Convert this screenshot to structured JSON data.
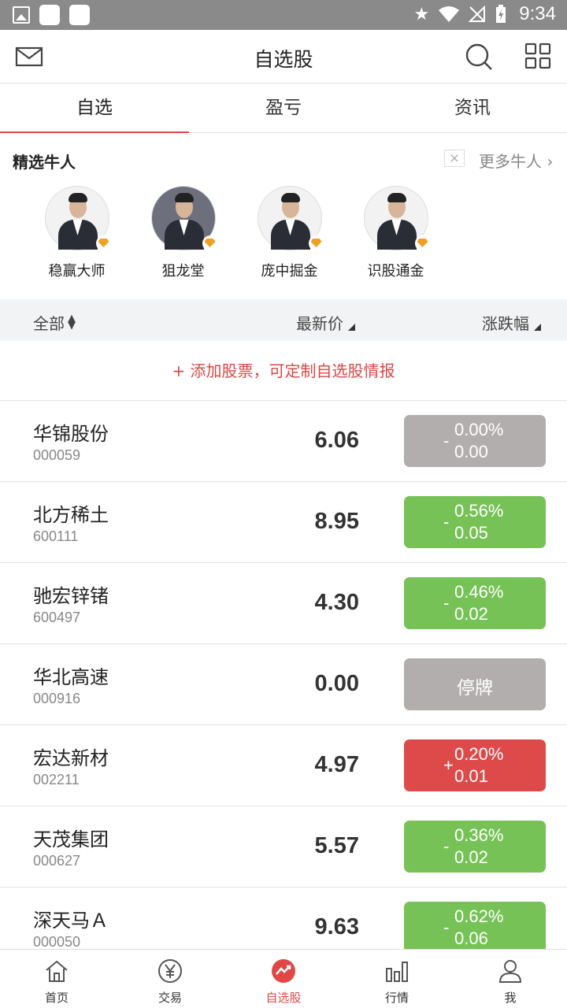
{
  "status_bar": {
    "time": "9:34"
  },
  "header": {
    "title": "自选股"
  },
  "tabs": [
    {
      "label": "自选",
      "active": true
    },
    {
      "label": "盈亏",
      "active": false
    },
    {
      "label": "资讯",
      "active": false
    }
  ],
  "experts": {
    "title": "精选牛人",
    "close_label": "×",
    "more_label": "更多牛人 ›",
    "items": [
      {
        "name": "稳赢大师"
      },
      {
        "name": "狙龙堂"
      },
      {
        "name": "庞中掘金"
      },
      {
        "name": "识股通金"
      }
    ]
  },
  "columns": {
    "all": "全部",
    "price": "最新价",
    "change": "涨跌幅"
  },
  "add_stock": {
    "label": "+ 添加股票，可定制自选股情报"
  },
  "stocks": [
    {
      "name": "华锦股份",
      "code": "000059",
      "price": "6.06",
      "sign": "-",
      "pct": "0.00%",
      "amt": "0.00",
      "status": "flat"
    },
    {
      "name": "北方稀土",
      "code": "600111",
      "price": "8.95",
      "sign": "-",
      "pct": "0.56%",
      "amt": "0.05",
      "status": "down"
    },
    {
      "name": "驰宏锌锗",
      "code": "600497",
      "price": "4.30",
      "sign": "-",
      "pct": "0.46%",
      "amt": "0.02",
      "status": "down"
    },
    {
      "name": "华北高速",
      "code": "000916",
      "price": "0.00",
      "halt": "停牌",
      "status": "halt"
    },
    {
      "name": "宏达新材",
      "code": "002211",
      "price": "4.97",
      "sign": "+",
      "pct": "0.20%",
      "amt": "0.01",
      "status": "up"
    },
    {
      "name": "天茂集团",
      "code": "000627",
      "price": "5.57",
      "sign": "-",
      "pct": "0.36%",
      "amt": "0.02",
      "status": "down"
    },
    {
      "name": "深天马Ａ",
      "code": "000050",
      "price": "9.63",
      "sign": "-",
      "pct": "0.62%",
      "amt": "0.06",
      "status": "down"
    }
  ],
  "colors": {
    "up": "#de4a4a",
    "down": "#76c256",
    "flat": "#b3aeae",
    "accent": "#e04848"
  },
  "bottom_nav": [
    {
      "label": "首页",
      "icon": "home-icon"
    },
    {
      "label": "交易",
      "icon": "yen-icon"
    },
    {
      "label": "自选股",
      "icon": "trend-icon",
      "active": true
    },
    {
      "label": "行情",
      "icon": "bar-chart-icon"
    },
    {
      "label": "我",
      "icon": "person-icon"
    }
  ]
}
